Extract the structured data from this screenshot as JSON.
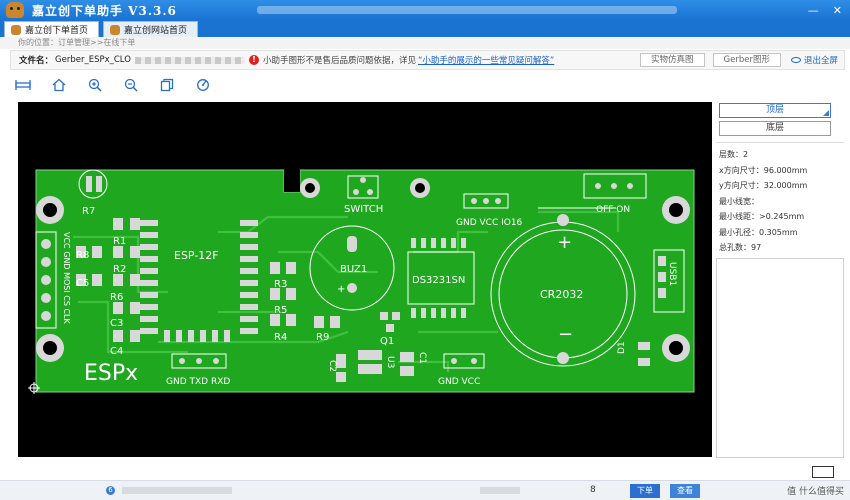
{
  "app": {
    "title": "嘉立创下单助手 V3.3.6",
    "window_controls": [
      "—",
      "✕"
    ]
  },
  "tabs": [
    {
      "label": "嘉立创下单首页",
      "active": true
    },
    {
      "label": "嘉立创网站首页",
      "active": false
    }
  ],
  "breadcrumb": "你的位置：订单管理>>在线下单",
  "filebar": {
    "file_label": "文件名：",
    "file_name": "Gerber_ESPx_CLO",
    "notice": "小助手图形不是售后品质问题依据，详见",
    "notice_link": "“小助手的展示的一些常见疑问解答”",
    "btn_real": "实物仿真图",
    "btn_gerber": "Gerber图形",
    "btn_exit": "退出全屏"
  },
  "toolbar": [
    "ruler-icon",
    "home-icon",
    "zoom-in-icon",
    "zoom-out-icon",
    "copy-icon",
    "rotate-icon"
  ],
  "layers": {
    "top": "顶层",
    "bottom": "底层"
  },
  "stats": {
    "layers": "层数：2",
    "x_size": "x方向尺寸：96.000mm",
    "y_size": "y方向尺寸：32.000mm",
    "min_width": "最小线宽：",
    "min_gap": "最小线距：>0.245mm",
    "min_hole": "最小孔径：0.305mm",
    "total_holes": "总孔数：97"
  },
  "pcb": {
    "labels": {
      "r7": "R7",
      "r1": "R1",
      "r8": "R8",
      "r2": "R2",
      "c5": "C5",
      "r6": "R6",
      "c3": "C3",
      "c4": "C4",
      "esp12f": "ESP-12F",
      "r3": "R3",
      "r5": "R5",
      "r4": "R4",
      "r9": "R9",
      "q1": "Q1",
      "c2": "C2",
      "u3": "U3",
      "c1": "C1",
      "d1": "D1",
      "switch": "SWITCH",
      "gnd_vcc_io16": "GND VCC IO16",
      "off_on": "OFF ON",
      "buz1": "BUZ1",
      "ds3231": "DS3231SN",
      "cr2032": "CR2032",
      "usb1": "USB1",
      "espx": "ESPx",
      "gnd_txd_rxd": "GND TXD RXD",
      "gnd_vcc": "GND VCC",
      "header": "VCC GND MOSI CS CLK",
      "plus": "+",
      "minus": "−"
    }
  },
  "bottom": {
    "row_num": "6",
    "qty": "8",
    "order_btn": "下单",
    "view_btn": "查看"
  },
  "watermark": "值 什么值得买",
  "colors": {
    "board": "#1fa81f",
    "board_edge": "#8ad08a",
    "silk": "#ffffff",
    "pad": "#d8d8d8",
    "accent": "#1a73d1"
  }
}
